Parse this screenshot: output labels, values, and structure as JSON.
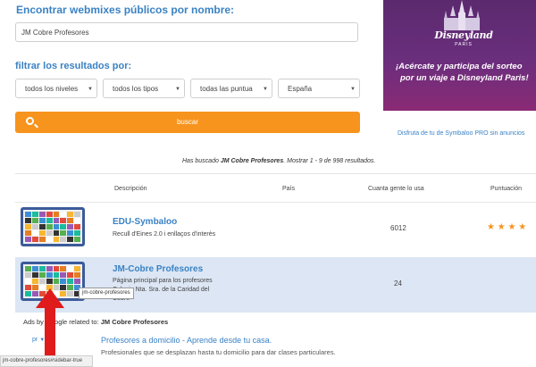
{
  "search_by_name": {
    "heading": "Encontrar webmixes públicos por nombre:",
    "value": "JM Cobre Profesores"
  },
  "filters": {
    "heading": "filtrar los resultados por:",
    "selects": [
      {
        "value": "todos los niveles"
      },
      {
        "value": "todos los tipos"
      },
      {
        "value": "todas las puntua"
      },
      {
        "value": "España"
      }
    ]
  },
  "search_button": {
    "label": "buscar"
  },
  "sidebar_ad": {
    "logo_text": "Disneyland",
    "logo_sub": "PARIS",
    "line1": "¡Acércate y participa del sorteo",
    "line2": "por un viaje a Disneyland Paris!",
    "link": "Disfruta de tu de Symbaloo PRO sin anuncios"
  },
  "results_summary": {
    "prefix": "Has buscado ",
    "query": "JM Cobre Profesores",
    "middle": ". Mostrar 1 - 9 de ",
    "total": "998",
    "suffix": " resultados."
  },
  "table": {
    "headers": [
      "Descripción",
      "País",
      "Cuanta gente lo usa",
      "Puntuación"
    ],
    "rows": [
      {
        "title": "EDU-Symbaloo",
        "desc_lines": [
          "Recull d'Eines 2.0 i enllaços d'interès"
        ],
        "users": "6012",
        "stars": "★ ★ ★ ★"
      },
      {
        "title": "JM-Cobre Profesores",
        "desc_lines": [
          "Página principal para los profesores",
          "Colegio Nta. Sra. de la Caridad del",
          "Cobre"
        ],
        "users": "24",
        "stars": ""
      }
    ]
  },
  "tooltip": "jm-cobre-profesores",
  "related": {
    "prefix": "Ads by Google related to: ",
    "query": "JM Cobre Profesores"
  },
  "google_ad": {
    "label": "pr",
    "title": "Profesores a domicilio - Aprende desde tu casa.",
    "desc": "Profesionales que se desplazan hasta tu domicilio para dar clases particulares."
  },
  "status_bar": "jm-cobre-profesores#sidebar-true",
  "colors": {
    "accent_orange": "#f7941d",
    "link_blue": "#3a82c4",
    "row_highlight": "#dce6f4",
    "arrow_red": "#e01b1b"
  }
}
